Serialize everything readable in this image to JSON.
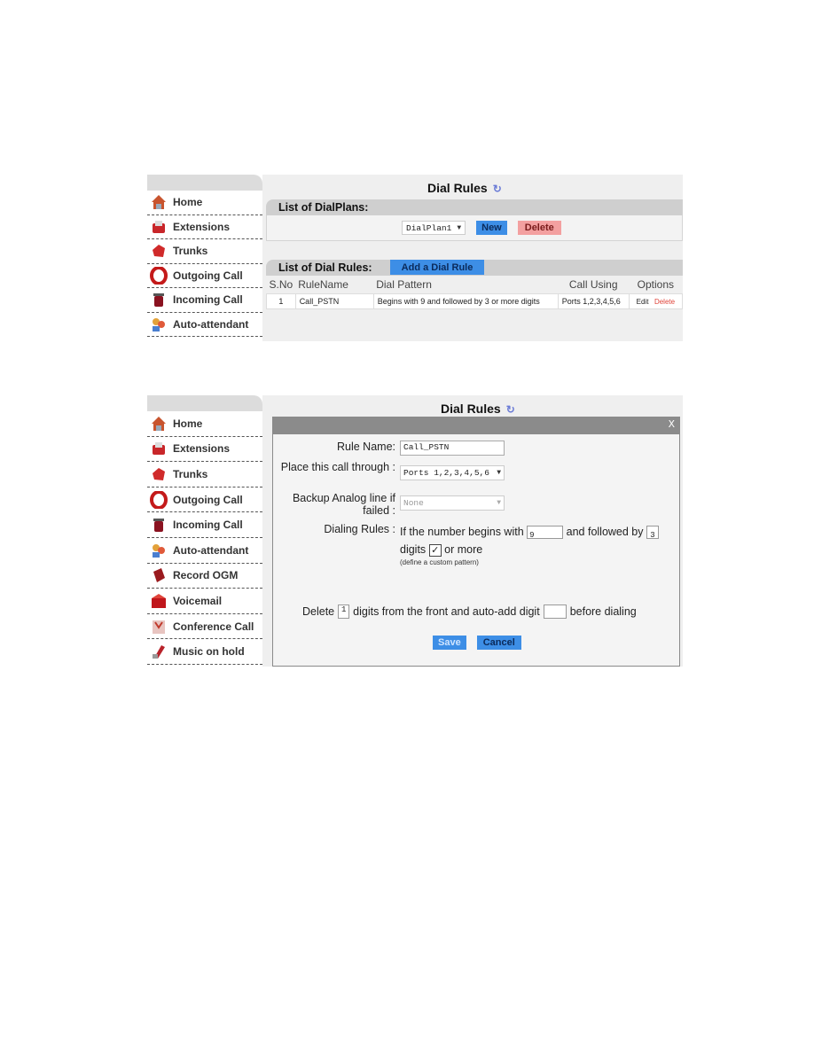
{
  "page_title": "Dial Rules",
  "sidebar": {
    "items": [
      {
        "label": "Home",
        "icon": "home-icon"
      },
      {
        "label": "Extensions",
        "icon": "extensions-icon"
      },
      {
        "label": "Trunks",
        "icon": "trunks-icon"
      },
      {
        "label": "Outgoing Call",
        "icon": "outgoing-call-icon"
      },
      {
        "label": "Incoming Call",
        "icon": "incoming-call-icon"
      },
      {
        "label": "Auto-attendant",
        "icon": "auto-attendant-icon"
      },
      {
        "label": "Record OGM",
        "icon": "record-ogm-icon"
      },
      {
        "label": "Voicemail",
        "icon": "voicemail-icon"
      },
      {
        "label": "Conference Call",
        "icon": "conference-call-icon"
      },
      {
        "label": "Music on hold",
        "icon": "music-on-hold-icon"
      }
    ]
  },
  "dialplans": {
    "section_title": "List of DialPlans:",
    "selected": "DialPlan1",
    "new_label": "New",
    "delete_label": "Delete"
  },
  "dial_rules": {
    "section_title": "List of Dial Rules:",
    "add_label": "Add a Dial Rule",
    "columns": [
      "S.No",
      "RuleName",
      "Dial Pattern",
      "Call Using",
      "Options"
    ],
    "rows": [
      {
        "sno": "1",
        "name": "Call_PSTN",
        "pattern": "Begins with 9 and followed by 3 or more digits",
        "call_using": "Ports 1,2,3,4,5,6",
        "edit": "Edit",
        "delete": "Delete"
      }
    ]
  },
  "modal": {
    "close": "X",
    "rule_name_label": "Rule Name:",
    "rule_name_value": "Call_PSTN",
    "place_label": "Place this call through :",
    "place_value": "Ports 1,2,3,4,5,6",
    "backup_label": "Backup Analog line if failed :",
    "backup_value": "None",
    "dialing_label": "Dialing Rules :",
    "begins_text": "If the number begins with",
    "begins_value": "9",
    "followed_text": "and followed by",
    "followed_value": "3",
    "digits_text": "digits",
    "or_more_text": "or more",
    "or_more_checked": "✓",
    "hint": "(define a custom pattern)",
    "delete_text": "Delete",
    "delete_value": "1",
    "front_text": "digits from the front and auto-add digit",
    "auto_add_value": "",
    "before_text": "before dialing",
    "save_label": "Save",
    "cancel_label": "Cancel"
  }
}
